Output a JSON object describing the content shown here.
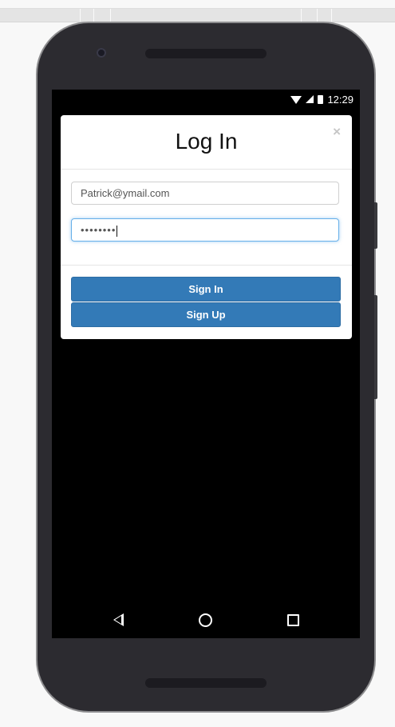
{
  "status_bar": {
    "time": "12:29"
  },
  "modal": {
    "title": "Log In",
    "close_label": "×"
  },
  "form": {
    "email_value": "Patrick@ymail.com",
    "password_mask": "••••••••"
  },
  "buttons": {
    "sign_in_label": "Sign In",
    "sign_up_label": "Sign Up"
  },
  "colors": {
    "primary": "#337ab7",
    "focus_border": "#66afe9"
  },
  "icons": {
    "status": [
      "wifi-icon",
      "signal-icon",
      "battery-icon"
    ],
    "nav": [
      "back-icon",
      "home-icon",
      "recent-apps-icon"
    ]
  }
}
